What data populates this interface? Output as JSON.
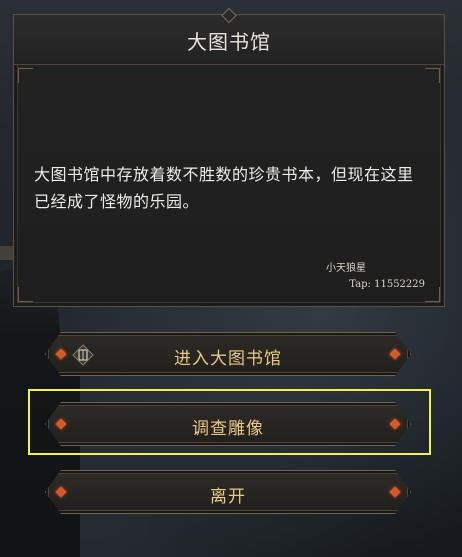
{
  "dialog": {
    "title": "大图书馆",
    "description": "大图书馆中存放着数不胜数的珍贵书本，但现在这里已经成了怪物的乐园。",
    "author": "小天狼星",
    "tap_label": "Tap: 11552229"
  },
  "options": [
    {
      "label": "进入大图书馆",
      "icon": "enter-gate-icon"
    },
    {
      "label": "调查雕像"
    },
    {
      "label": "离开"
    }
  ],
  "highlight": {
    "color": "#f2f24a",
    "target": "调查雕像"
  },
  "colors": {
    "option_text": "#e8c98a",
    "diamond_accent": "#d45a2a",
    "panel_bg": "#222222"
  }
}
